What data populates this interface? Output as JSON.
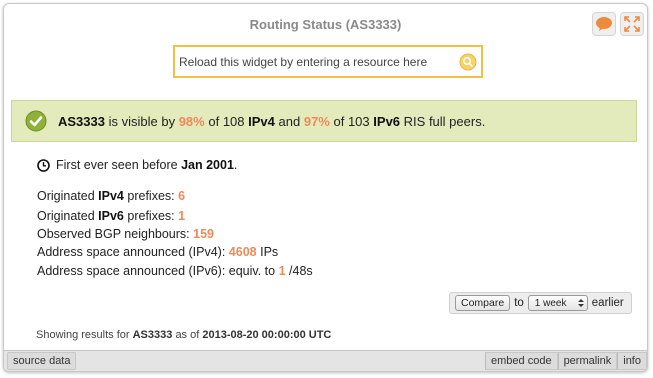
{
  "title": "Routing Status (AS3333)",
  "reload": {
    "placeholder": "Reload this widget by entering a resource here"
  },
  "banner": {
    "asn": "AS3333",
    "t1": "is visible by",
    "v4_pct": "98%",
    "t2": "of 108",
    "v4_label": "IPv4",
    "t3": "and",
    "v6_pct": "97%",
    "t4": "of 103",
    "v6_label": "IPv6",
    "t5": "RIS full peers."
  },
  "first_seen": {
    "prefix": "First ever seen before",
    "date": "Jan 2001",
    "suffix": "."
  },
  "stats": {
    "ipv4_prefixes": {
      "pre": "Originated",
      "bold": "IPv4",
      "post": "prefixes:",
      "value": "6"
    },
    "ipv6_prefixes": {
      "pre": "Originated",
      "bold": "IPv6",
      "post": "prefixes:",
      "value": "1"
    },
    "bgp": {
      "label": "Observed BGP neighbours:",
      "value": "159"
    },
    "space_v4": {
      "label": "Address space announced (IPv4):",
      "value": "4608",
      "unit": "IPs"
    },
    "space_v6": {
      "label": "Address space announced (IPv6): equiv. to",
      "value": "1",
      "unit": "/48s"
    }
  },
  "compare": {
    "button": "Compare",
    "to": "to",
    "period": "1 week",
    "earlier": "earlier"
  },
  "status": {
    "prefix": "Showing results for",
    "asn": "AS3333",
    "mid": "as of",
    "timestamp": "2013-08-20 00:00:00 UTC"
  },
  "footer": {
    "source": "source data",
    "embed": "embed code",
    "permalink": "permalink",
    "info": "info"
  },
  "colors": {
    "accent": "#ee8a5a",
    "banner_bg": "#e3ebbc",
    "reload_border": "#f1c048"
  },
  "icons": [
    "speech-bubble-icon",
    "expand-icon",
    "magnifier-icon",
    "checkmark-icon",
    "clock-icon",
    "select-arrows-icon"
  ]
}
